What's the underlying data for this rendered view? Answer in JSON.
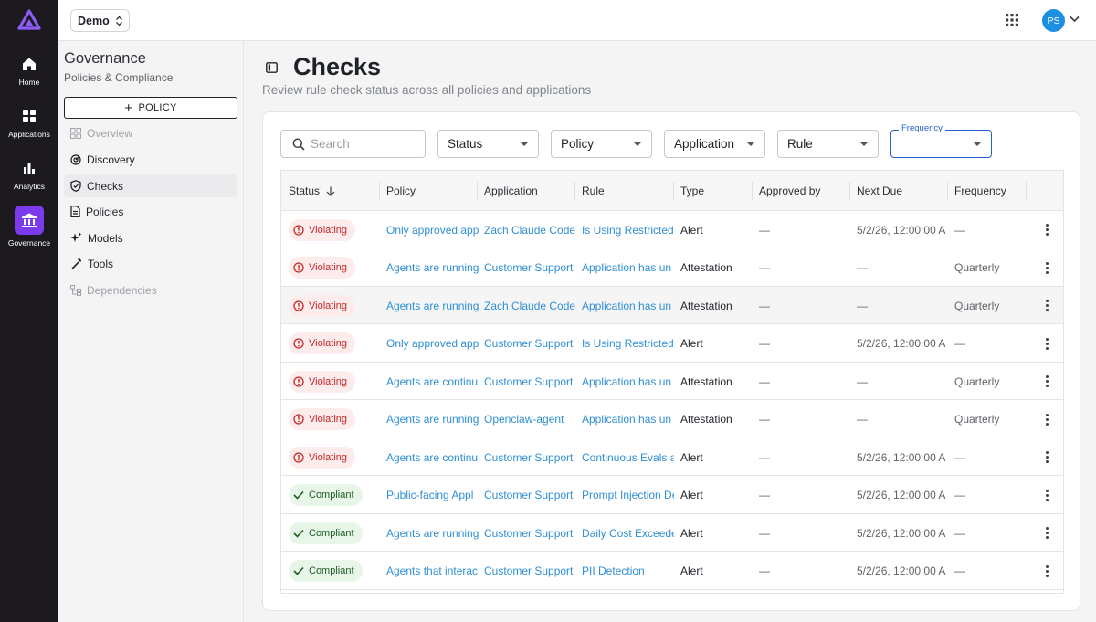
{
  "rail": {
    "items": [
      {
        "id": "home",
        "label": "Home",
        "icon": "home-icon"
      },
      {
        "id": "applications",
        "label": "Applications",
        "icon": "grid-icon"
      },
      {
        "id": "analytics",
        "label": "Analytics",
        "icon": "bar-chart-icon"
      },
      {
        "id": "governance",
        "label": "Governance",
        "icon": "bank-icon",
        "active": true
      }
    ],
    "accent": "#7c3aed"
  },
  "topbar": {
    "workspace": "Demo",
    "avatar_initials": "PS",
    "avatar_color": "#1d8fe0"
  },
  "subnav": {
    "title": "Governance",
    "subtitle": "Policies & Compliance",
    "new_policy_label": "POLICY",
    "items": [
      {
        "label": "Overview",
        "icon": "dashboard-icon",
        "disabled": true
      },
      {
        "label": "Discovery",
        "icon": "radar-icon"
      },
      {
        "label": "Checks",
        "icon": "shield-check-icon",
        "active": true
      },
      {
        "label": "Policies",
        "icon": "document-icon"
      },
      {
        "label": "Models",
        "icon": "sparkle-icon"
      },
      {
        "label": "Tools",
        "icon": "wrench-icon"
      },
      {
        "label": "Dependencies",
        "icon": "tree-icon",
        "disabled": true
      }
    ]
  },
  "main": {
    "title": "Checks",
    "subtitle": "Review rule check status across all policies and applications",
    "filters": {
      "search_placeholder": "Search",
      "status": "Status",
      "policy": "Policy",
      "application": "Application",
      "rule": "Rule",
      "frequency_label": "Frequency",
      "frequency_value": ""
    },
    "table": {
      "columns": [
        "Status",
        "Policy",
        "Application",
        "Rule",
        "Type",
        "Approved by",
        "Next Due",
        "Frequency"
      ],
      "rows": [
        {
          "status": "Violating",
          "policy": "Only approved app",
          "application": "Zach Claude Code",
          "rule": "Is Using Restricted",
          "type": "Alert",
          "approved_by": "—",
          "next_due": "5/2/26, 12:00:00 A",
          "frequency": "—"
        },
        {
          "status": "Violating",
          "policy": "Agents are running",
          "application": "Customer Support",
          "rule": "Application has un",
          "type": "Attestation",
          "approved_by": "—",
          "next_due": "—",
          "frequency": "Quarterly"
        },
        {
          "status": "Violating",
          "policy": "Agents are running",
          "application": "Zach Claude Code",
          "rule": "Application has un",
          "type": "Attestation",
          "approved_by": "—",
          "next_due": "—",
          "frequency": "Quarterly"
        },
        {
          "status": "Violating",
          "policy": "Only approved app",
          "application": "Customer Support",
          "rule": "Is Using Restricted",
          "type": "Alert",
          "approved_by": "—",
          "next_due": "5/2/26, 12:00:00 A",
          "frequency": "—"
        },
        {
          "status": "Violating",
          "policy": "Agents are continu",
          "application": "Customer Support",
          "rule": "Application has un",
          "type": "Attestation",
          "approved_by": "—",
          "next_due": "—",
          "frequency": "Quarterly"
        },
        {
          "status": "Violating",
          "policy": "Agents are running",
          "application": "Openclaw-agent",
          "rule": "Application has un",
          "type": "Attestation",
          "approved_by": "—",
          "next_due": "—",
          "frequency": "Quarterly"
        },
        {
          "status": "Violating",
          "policy": "Agents are continu",
          "application": "Customer Support",
          "rule": "Continuous Evals a",
          "type": "Alert",
          "approved_by": "—",
          "next_due": "5/2/26, 12:00:00 A",
          "frequency": "—"
        },
        {
          "status": "Compliant",
          "policy": "Public-facing Appl",
          "application": "Customer Support",
          "rule": "Prompt Injection De",
          "type": "Alert",
          "approved_by": "—",
          "next_due": "5/2/26, 12:00:00 A",
          "frequency": "—"
        },
        {
          "status": "Compliant",
          "policy": "Agents are running",
          "application": "Customer Support",
          "rule": "Daily Cost Exceede",
          "type": "Alert",
          "approved_by": "—",
          "next_due": "5/2/26, 12:00:00 A",
          "frequency": "—"
        },
        {
          "status": "Compliant",
          "policy": "Agents that interac",
          "application": "Customer Support",
          "rule": "PII Detection",
          "type": "Alert",
          "approved_by": "—",
          "next_due": "5/2/26, 12:00:00 A",
          "frequency": "—"
        }
      ]
    },
    "colors": {
      "link": "#2f8fd6",
      "violating": "#c62828",
      "compliant": "#1b5e20",
      "focus": "#2563c9"
    }
  }
}
